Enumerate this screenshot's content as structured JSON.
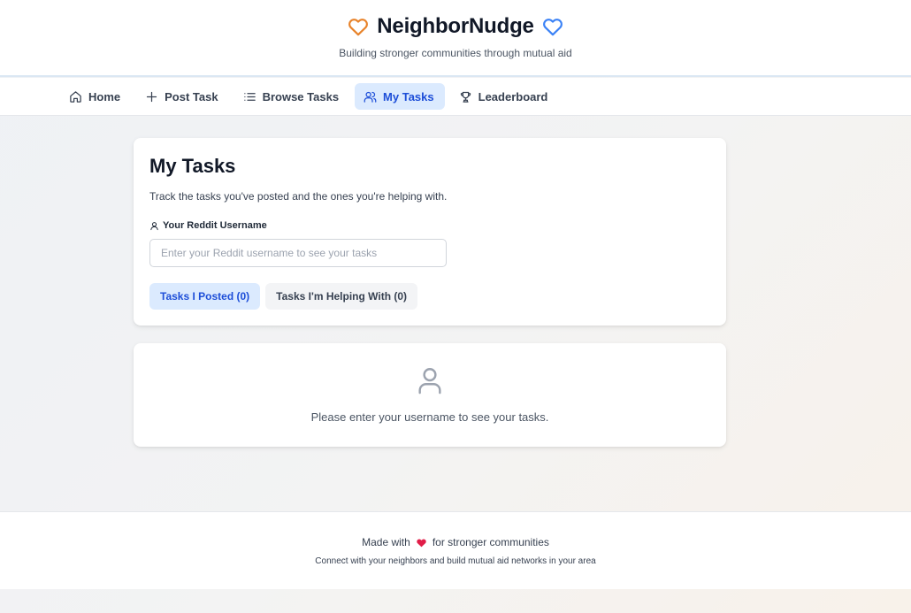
{
  "app": {
    "title": "NeighborNudge",
    "tagline": "Building stronger communities through mutual aid",
    "accent_left_heart": "#e8832a",
    "accent_right_heart": "#3b82f6"
  },
  "nav": {
    "items": [
      {
        "label": "Home",
        "icon": "home-icon",
        "active": false
      },
      {
        "label": "Post Task",
        "icon": "plus-icon",
        "active": false
      },
      {
        "label": "Browse Tasks",
        "icon": "list-icon",
        "active": false
      },
      {
        "label": "My Tasks",
        "icon": "users-icon",
        "active": true
      },
      {
        "label": "Leaderboard",
        "icon": "trophy-icon",
        "active": false
      }
    ]
  },
  "main": {
    "title": "My Tasks",
    "description": "Track the tasks you've posted and the ones you're helping with.",
    "username_label": "Your Reddit Username",
    "username_value": "",
    "username_placeholder": "Enter your Reddit username to see your tasks",
    "tabs": [
      {
        "label": "Tasks I Posted (0)",
        "active": true
      },
      {
        "label": "Tasks I'm Helping With (0)",
        "active": false
      }
    ]
  },
  "empty_state": {
    "icon": "user-icon",
    "message": "Please enter your username to see your tasks."
  },
  "footer": {
    "made_with": "Made with",
    "for_text": "for stronger communities",
    "heart_color": "#e11d48",
    "subtext": "Connect with your neighbors and build mutual aid networks in your area"
  }
}
